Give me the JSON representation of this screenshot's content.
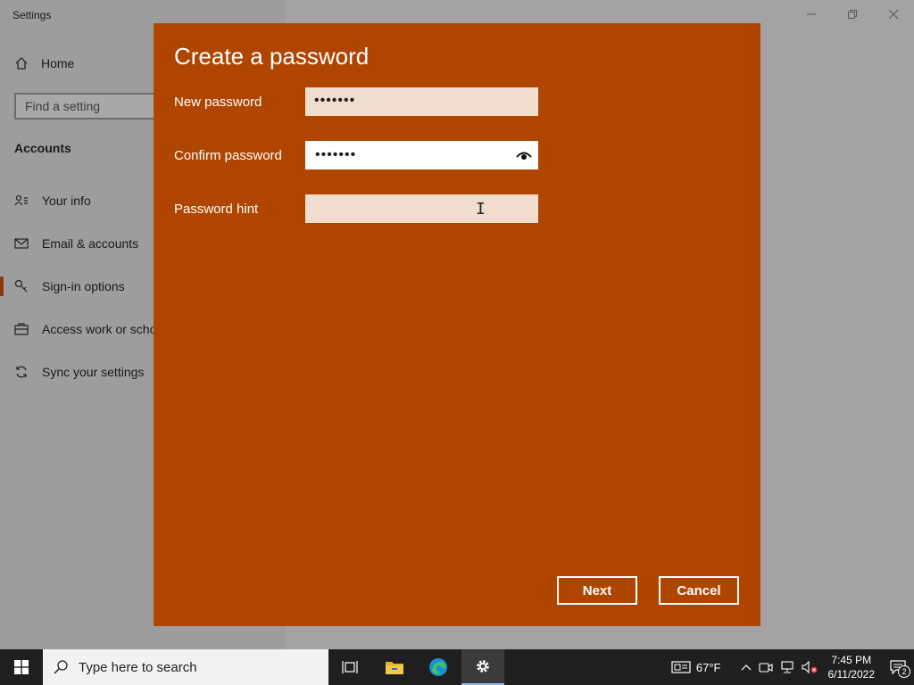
{
  "window": {
    "title": "Settings",
    "controls": [
      "minimize",
      "restore",
      "close"
    ]
  },
  "sidebar": {
    "home_label": "Home",
    "search_placeholder": "Find a setting",
    "section_title": "Accounts",
    "items": [
      {
        "label": "Your info",
        "icon": "person-info-icon"
      },
      {
        "label": "Email & accounts",
        "icon": "mail-icon"
      },
      {
        "label": "Sign-in options",
        "icon": "key-icon",
        "active": true
      },
      {
        "label": "Access work or scho",
        "icon": "briefcase-icon"
      },
      {
        "label": "Sync your settings",
        "icon": "sync-icon"
      }
    ]
  },
  "dialog": {
    "title": "Create a password",
    "new_password_label": "New password",
    "new_password_value": "•••••••",
    "confirm_password_label": "Confirm password",
    "confirm_password_value": "•••••••",
    "hint_label": "Password hint",
    "hint_value": "",
    "next_label": "Next",
    "cancel_label": "Cancel",
    "accent_color": "#b04500"
  },
  "taskbar": {
    "search_placeholder": "Type here to search",
    "weather": "67°F",
    "time": "7:45 PM",
    "date": "6/11/2022",
    "notification_count": "2"
  }
}
